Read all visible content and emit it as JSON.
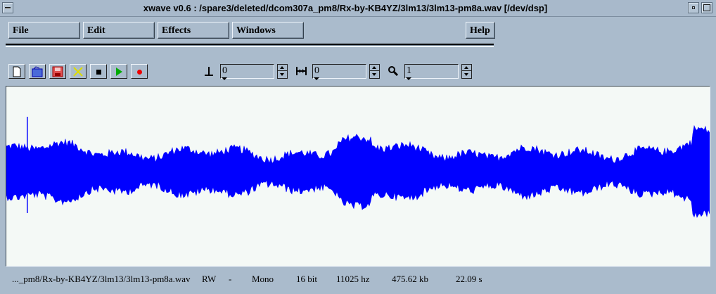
{
  "window": {
    "title": "xwave v0.6 : /spare3/deleted/dcom307a_pm8/Rx-by-KB4YZ/3lm13/3lm13-pm8a.wav [/dev/dsp]",
    "titlebar_buttons": {
      "menu_icon": "window-menu-icon",
      "minimize_icon": "minimize-icon",
      "maximize_icon": "maximize-icon"
    }
  },
  "menubar": {
    "file": "File",
    "edit": "Edit",
    "effects": "Effects",
    "windows": "Windows",
    "help": "Help"
  },
  "toolbar": {
    "buttons": [
      "new-file-icon",
      "open-file-icon",
      "save-file-icon",
      "close-file-icon",
      "stop-icon",
      "play-icon",
      "record-icon"
    ],
    "colors": {
      "open": "#0000cc",
      "save": "#cc0000",
      "close": "#dddd00",
      "play": "#00aa00",
      "record": "#ee0000"
    },
    "position_field": {
      "icon": "position-marker-icon",
      "value": "0"
    },
    "length_field": {
      "icon": "length-range-icon",
      "value": "0"
    },
    "zoom_field": {
      "icon": "zoom-icon",
      "value": "1"
    }
  },
  "waveform": {
    "color": "#0000ff",
    "background": "#f4f9f6"
  },
  "status": {
    "filename": "..._pm8/Rx-by-KB4YZ/3lm13/3lm13-pm8a.wav",
    "mode": "RW",
    "dash": "-",
    "channels": "Mono",
    "bits": "16 bit",
    "rate": "11025 hz",
    "size": "475.62 kb",
    "duration": "22.09 s"
  }
}
